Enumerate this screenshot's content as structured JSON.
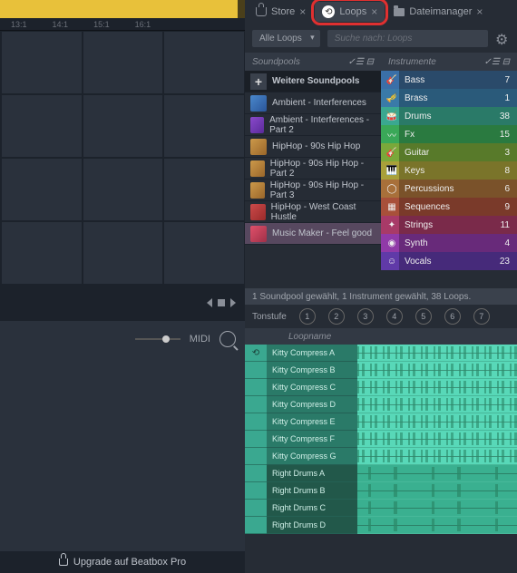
{
  "ruler": [
    "13:1",
    "14:1",
    "15:1",
    "16:1"
  ],
  "midi_label": "MIDI",
  "upgrade_label": "Upgrade auf Beatbox Pro",
  "tabs": {
    "store": "Store",
    "loops": "Loops",
    "filemanager": "Dateimanager"
  },
  "filter": {
    "dropdown": "Alle Loops",
    "search_placeholder": "Suche nach: Loops"
  },
  "columns": {
    "soundpools": "Soundpools",
    "instrumente": "Instrumente",
    "header_icons": "✓☰ ⊟"
  },
  "soundpools": {
    "more": "Weitere Soundpools",
    "items": [
      "Ambient - Interferences",
      "Ambient - Interferences - Part 2",
      "HipHop - 90s Hip Hop",
      "HipHop - 90s Hip Hop - Part 2",
      "HipHop - 90s Hip Hop - Part 3",
      "HipHop - West Coast Hustle",
      "Music Maker - Feel good"
    ]
  },
  "instruments": [
    {
      "name": "Bass",
      "count": 7,
      "cls": "i-bass",
      "icon": "🎸"
    },
    {
      "name": "Brass",
      "count": 1,
      "cls": "i-brass",
      "icon": "🎺"
    },
    {
      "name": "Drums",
      "count": 38,
      "cls": "i-drums",
      "icon": "🥁"
    },
    {
      "name": "Fx",
      "count": 15,
      "cls": "i-fx",
      "icon": "〰"
    },
    {
      "name": "Guitar",
      "count": 3,
      "cls": "i-guitar",
      "icon": "🎸"
    },
    {
      "name": "Keys",
      "count": 8,
      "cls": "i-keys",
      "icon": "🎹"
    },
    {
      "name": "Percussions",
      "count": 6,
      "cls": "i-perc",
      "icon": "◯"
    },
    {
      "name": "Sequences",
      "count": 9,
      "cls": "i-seq",
      "icon": "▦"
    },
    {
      "name": "Strings",
      "count": 11,
      "cls": "i-strings",
      "icon": "✦"
    },
    {
      "name": "Synth",
      "count": 4,
      "cls": "i-synth",
      "icon": "◉"
    },
    {
      "name": "Vocals",
      "count": 23,
      "cls": "i-vocals",
      "icon": "☺"
    }
  ],
  "status": "1 Soundpool gewählt, 1 Instrument gewählt, 38 Loops.",
  "tonstufe_label": "Tonstufe",
  "pitches": [
    "1",
    "2",
    "3",
    "4",
    "5",
    "6",
    "7"
  ],
  "loopname_header": "Loopname",
  "loops": [
    {
      "name": "Kitty Compress A",
      "dense": true
    },
    {
      "name": "Kitty Compress B",
      "dense": true
    },
    {
      "name": "Kitty Compress C",
      "dense": true
    },
    {
      "name": "Kitty Compress D",
      "dense": true
    },
    {
      "name": "Kitty Compress E",
      "dense": true
    },
    {
      "name": "Kitty Compress F",
      "dense": true
    },
    {
      "name": "Kitty Compress G",
      "dense": true
    },
    {
      "name": "Right Drums A",
      "dense": false
    },
    {
      "name": "Right Drums B",
      "dense": false
    },
    {
      "name": "Right Drums C",
      "dense": false
    },
    {
      "name": "Right Drums D",
      "dense": false
    }
  ]
}
